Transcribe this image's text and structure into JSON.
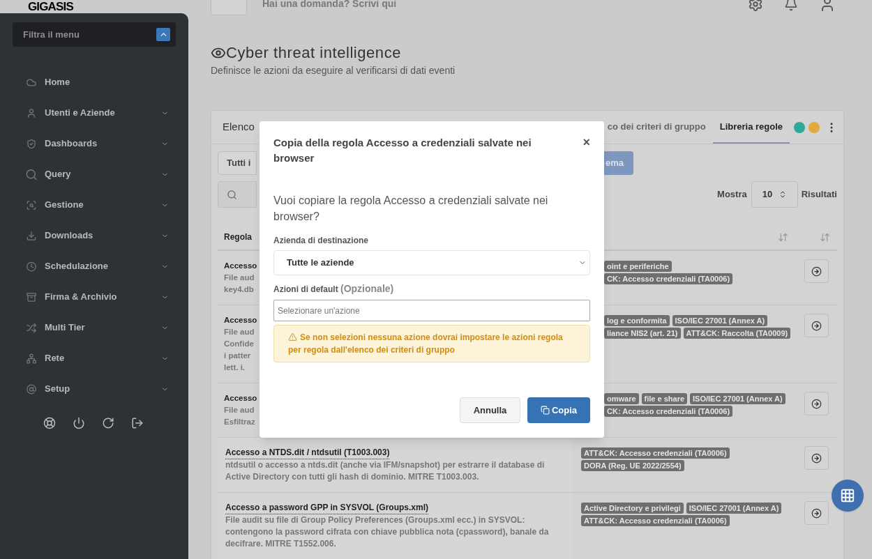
{
  "logo": "GIGASIS",
  "sidebar": {
    "filter_placeholder": "Filtra il menu",
    "items": [
      {
        "label": "Home",
        "expandable": false
      },
      {
        "label": "Utenti e Aziende",
        "expandable": true
      },
      {
        "label": "Dashboards",
        "expandable": true
      },
      {
        "label": "Query",
        "expandable": true
      },
      {
        "label": "Gestione",
        "expandable": true
      },
      {
        "label": "Downloads",
        "expandable": true
      },
      {
        "label": "Schedulazione",
        "expandable": true
      },
      {
        "label": "Firma & Archivio",
        "expandable": true
      },
      {
        "label": "Multi Tier",
        "expandable": true
      },
      {
        "label": "Rete",
        "expandable": true
      },
      {
        "label": "Setup",
        "expandable": true
      }
    ]
  },
  "topbar": {
    "question": "Hai una domanda? Scrivi qui"
  },
  "page": {
    "title": "Cyber threat intelligence",
    "subtitle": "Definisce le azioni da eseguire al verificarsi di dati eventi"
  },
  "card": {
    "title": "Elenco",
    "tabs": [
      {
        "label": "co dei criteri di gruppo",
        "selected": false
      },
      {
        "label": "Libreria regole",
        "selected": true
      }
    ],
    "status_dots": [
      {
        "color": "#2fa89a"
      },
      {
        "color": "#e2a93b"
      }
    ],
    "filter_button": "Tutti i",
    "action_button": "ema",
    "show_label": "Mostra",
    "page_size": "10",
    "results_label": "Risultati",
    "column_header": "Regola",
    "covered_rows": [
      {
        "lines": [
          "Accesso",
          "File aud",
          "key4.db"
        ],
        "tag_lines": [
          [
            "oint e periferiche"
          ],
          [
            "CK: Accesso credenziali (TA0006)"
          ]
        ]
      },
      {
        "lines": [
          "Accesso",
          "File aud",
          "Confide",
          "i patter",
          "lett. i."
        ],
        "tag_lines": [
          [
            "log e conformita",
            "ISO/IEC 27001 (Annex A)"
          ],
          [
            "liance NIS2 (art. 21)",
            "ATT&CK: Raccolta (TA0009)"
          ]
        ]
      },
      {
        "lines": [
          "Accesso",
          "File aud",
          "Esfiltraz"
        ],
        "tag_lines": [
          [
            "omware",
            "file e share",
            "ISO/IEC 27001 (Annex A)"
          ],
          [
            "CK: Accesso credenziali (TA0006)"
          ]
        ]
      }
    ],
    "rows": [
      {
        "title": "Accesso a NTDS.dit / ntdsutil (T1003.003)",
        "description": "ntdsutil o accesso a ntds.dit (anche via IFM/snapshot) per estrarre il database di Active Directory con tutti gli hash di dominio. MITRE T1003.003.",
        "tag_lines": [
          [
            "ATT&CK: Accesso credenziali (TA0006)"
          ],
          [
            "DORA (Reg. UE 2022/2554)"
          ]
        ]
      },
      {
        "title": "Accesso a password GPP in SYSVOL (Groups.xml)",
        "description": "File audit su file di Group Policy Preferences (Groups.xml ecc.) in SYSVOL: contengono la password cifrata con chiave pubblica nota (cpassword), banale da decifrare. MITRE T1552.006.",
        "tag_lines": [
          [
            "Active Directory e privilegi",
            "ISO/IEC 27001 (Annex A)"
          ],
          [
            "ATT&CK: Accesso credenziali (TA0006)"
          ]
        ]
      }
    ]
  },
  "modal": {
    "title": "Copia della regola Accesso a credenziali salvate nei browser",
    "close": "×",
    "question": "Vuoi copiare la regola Accesso a credenziali salvate nei browser?",
    "company_label": "Azienda di destinazione",
    "company_value": "Tutte le aziende",
    "actions_label": "Azioni di default",
    "actions_note": "(Opzionale)",
    "actions_placeholder": "Selezionare un'azione",
    "warning": "Se non selezioni nessuna azione dovrai impostare le azioni regola per regola dall'elenco dei criteri di gruppo",
    "cancel": "Annulla",
    "confirm": "Copia"
  }
}
